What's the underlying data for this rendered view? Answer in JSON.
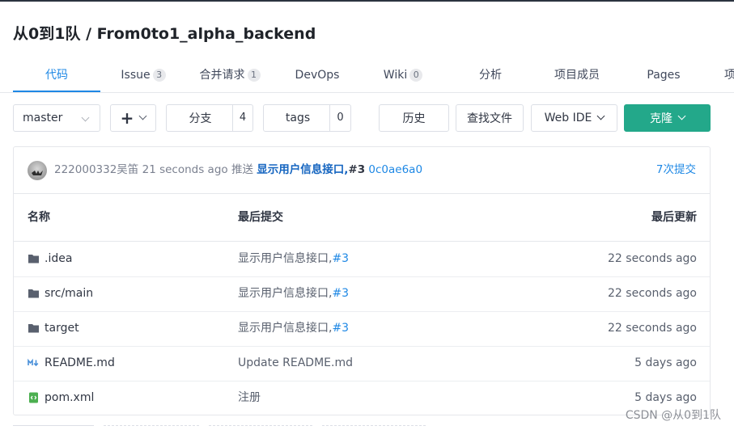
{
  "repo": {
    "owner": "从0到1队",
    "separator": " / ",
    "name": "From0to1_alpha_backend"
  },
  "tabs": [
    {
      "label": "代码",
      "badge": null
    },
    {
      "label": "Issue",
      "badge": "3"
    },
    {
      "label": "合并请求",
      "badge": "1"
    },
    {
      "label": "DevOps",
      "badge": null
    },
    {
      "label": "Wiki",
      "badge": "0"
    },
    {
      "label": "分析",
      "badge": null
    },
    {
      "label": "项目成员",
      "badge": null
    },
    {
      "label": "Pages",
      "badge": null
    },
    {
      "label": "项",
      "badge": null
    }
  ],
  "toolbar": {
    "branch_select": "master",
    "add_button": "+",
    "branches_label": "分支",
    "branches_count": "4",
    "tags_label": "tags",
    "tags_count": "0",
    "history_label": "历史",
    "find_file_label": "查找文件",
    "web_ide_label": "Web IDE",
    "clone_label": "克隆"
  },
  "last_commit": {
    "author": "222000332吴笛",
    "time": "21 seconds ago",
    "action": "推送",
    "message": "显示用户信息接口,",
    "ref": "#3",
    "hash": "0c0ae6a0",
    "commit_count": "7次提交"
  },
  "table": {
    "headers": {
      "name": "名称",
      "last_commit": "最后提交",
      "last_update": "最后更新"
    },
    "rows": [
      {
        "icon": "folder-icon",
        "name": ".idea",
        "message": "显示用户信息接口,",
        "ref": "#3",
        "time": "22 seconds ago"
      },
      {
        "icon": "folder-icon",
        "name": "src/main",
        "message": "显示用户信息接口,",
        "ref": "#3",
        "time": "22 seconds ago"
      },
      {
        "icon": "folder-icon",
        "name": "target",
        "message": "显示用户信息接口,",
        "ref": "#3",
        "time": "22 seconds ago"
      },
      {
        "icon": "markdown-icon",
        "name": "README.md",
        "message": "Update README.md",
        "ref": "",
        "time": "5 days ago"
      },
      {
        "icon": "xml-file-icon",
        "name": "pom.xml",
        "message": "注册",
        "ref": "",
        "time": "5 days ago"
      }
    ]
  },
  "watermark": "CSDN @从0到1队",
  "colors": {
    "accent": "#1e88e5",
    "clone_button": "#23a88a",
    "markdown_icon": "#4a90d9",
    "xml_icon": "#4caf50"
  }
}
